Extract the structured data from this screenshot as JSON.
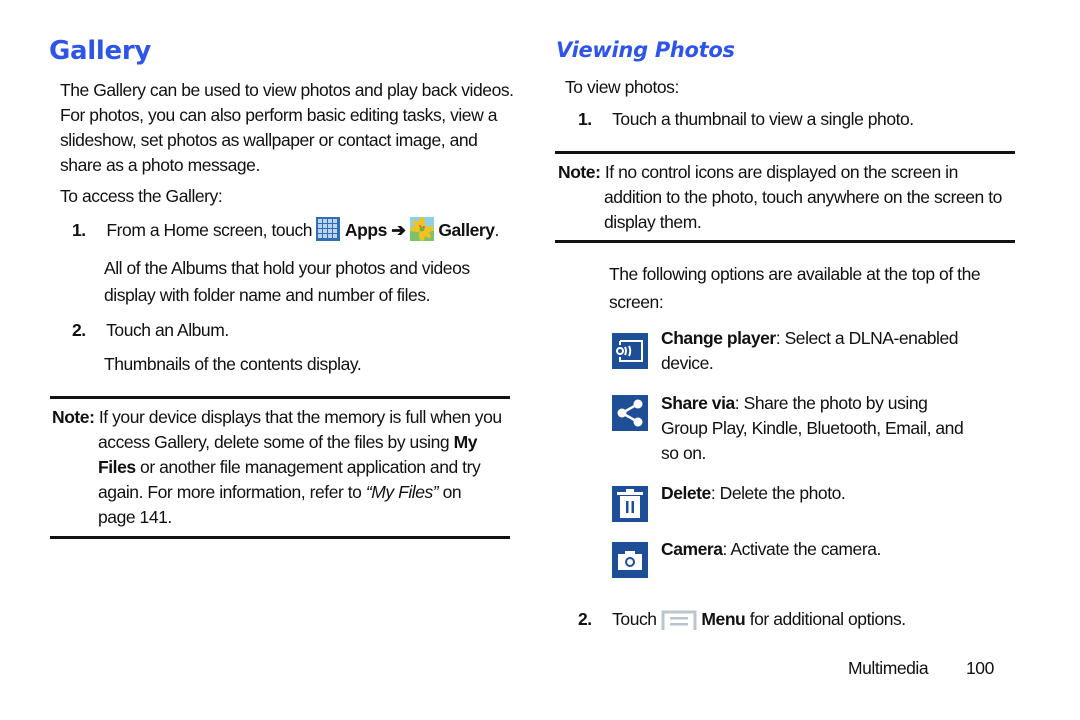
{
  "left": {
    "title": "Gallery",
    "intro": [
      "The Gallery can be used to view photos and play back videos.",
      "For photos, you can also perform basic editing tasks, view a",
      "slideshow, set photos as wallpaper or contact image, and",
      "share as a photo message."
    ],
    "access_label": "To access the Gallery:",
    "step1": {
      "number": "1.",
      "text": "From a Home screen, touch",
      "apps_label": "Apps",
      "arrow": "➔",
      "gallery_label": "Gallery",
      "period": ".",
      "detail": [
        "All of the Albums that hold your photos and videos",
        "display with folder name and number of files."
      ]
    },
    "step2": {
      "number": "2.",
      "text": "Touch an Album.",
      "detail": "Thumbnails of the contents display."
    },
    "note": {
      "label": "Note:",
      "line1": "If your device displays that the memory is full when you",
      "line2a": "access Gallery, delete some of the files by using ",
      "line2b": "My",
      "line3a": "Files",
      "line3b": " or another file management application and try",
      "line4a": "again. For more information, refer to ",
      "line4b": "“My Files”",
      "line4c": " on",
      "line5": "page 141."
    }
  },
  "right": {
    "title": "Viewing Photos",
    "intro": "To view photos:",
    "step1": {
      "number": "1.",
      "text": "Touch a thumbnail to view a single photo."
    },
    "note": {
      "label": "Note:",
      "line1": "If no control icons are displayed on the screen in",
      "line2": "addition to the photo, touch anywhere on the screen to",
      "line3": "display them."
    },
    "options_intro": [
      "The following options are available at the top of the",
      "screen:"
    ],
    "options": [
      {
        "icon": "change-player-icon",
        "name": "Change player",
        "desc_lines": [
          ": Select a DLNA-enabled",
          "device."
        ]
      },
      {
        "icon": "share-icon",
        "name": "Share via",
        "desc_lines": [
          ": Share the photo by using",
          "Group Play, Kindle, Bluetooth, Email, and",
          "so on."
        ]
      },
      {
        "icon": "delete-icon",
        "name": "Delete",
        "desc_lines": [
          ": Delete the photo."
        ]
      },
      {
        "icon": "camera-icon",
        "name": "Camera",
        "desc_lines": [
          ": Activate the camera."
        ]
      }
    ],
    "step2": {
      "number": "2.",
      "text_before": "Touch",
      "menu_label": "Menu",
      "text_after": " for additional options."
    }
  },
  "footer": {
    "section": "Multimedia",
    "page": "100"
  },
  "colors": {
    "heading": "#2f55e8",
    "icon_bg": "#1e4f96",
    "text": "#111111"
  }
}
